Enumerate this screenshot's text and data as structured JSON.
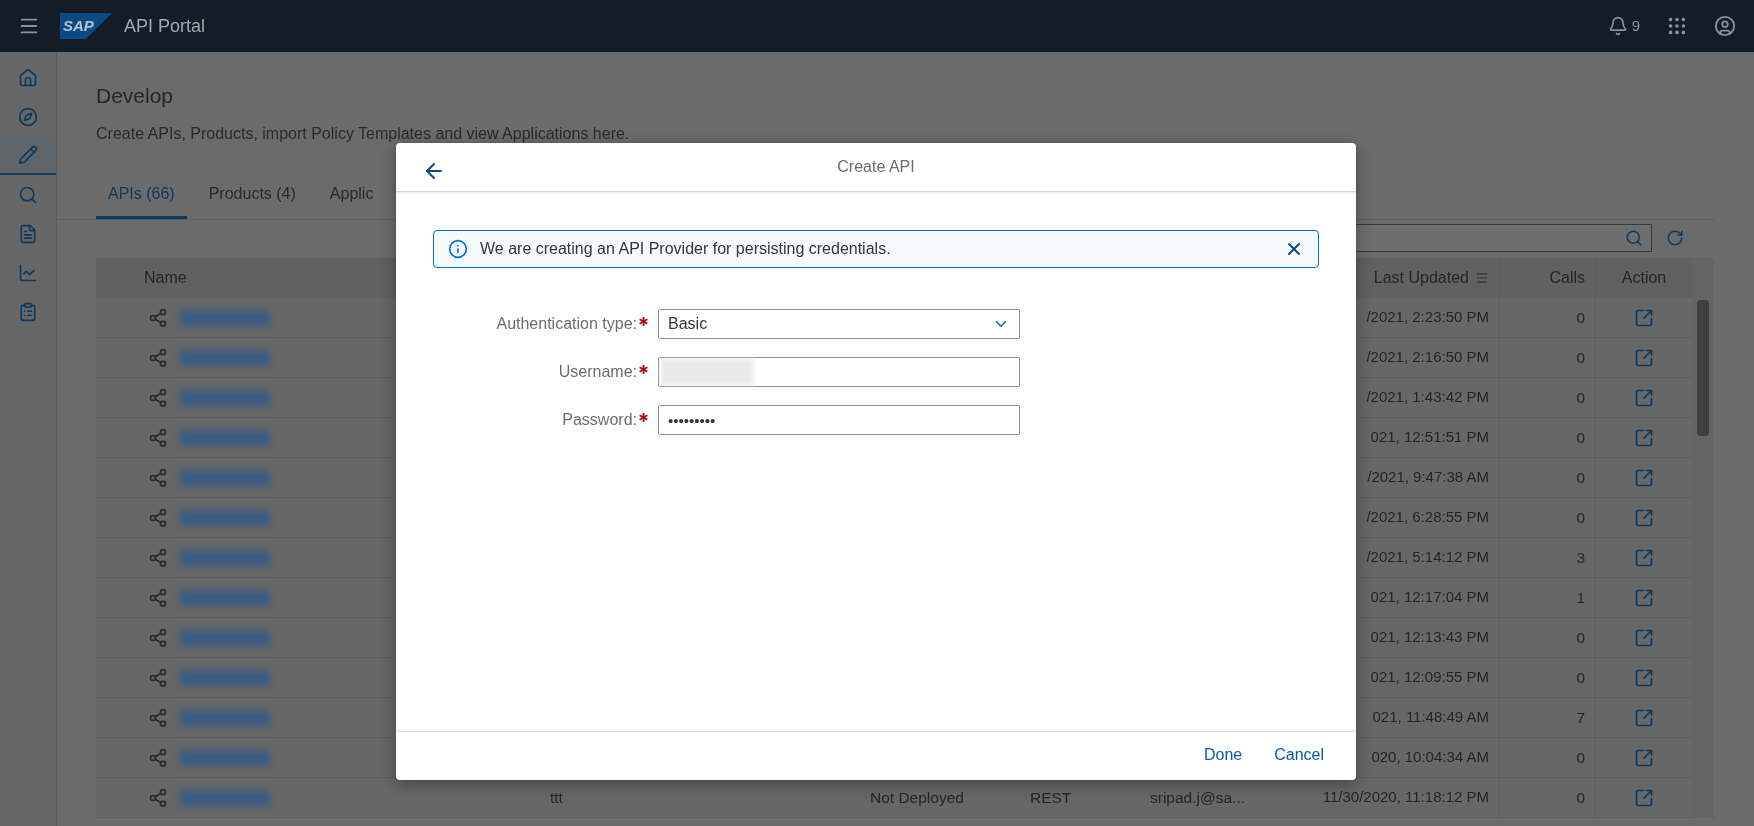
{
  "shell": {
    "logo": "SAP",
    "title": "API Portal",
    "notification_count": "9"
  },
  "nav": [
    {
      "selected": false
    },
    {
      "selected": false
    },
    {
      "selected": true
    },
    {
      "selected": false
    },
    {
      "selected": false
    },
    {
      "selected": false
    },
    {
      "selected": false
    }
  ],
  "page": {
    "title": "Develop",
    "subtitle": "Create APIs, Products, import Policy Templates and view Applications here."
  },
  "tabs": [
    {
      "label": "APIs (66)",
      "selected": true
    },
    {
      "label": "Products (4)",
      "selected": false
    },
    {
      "label": "Applic",
      "selected": false
    }
  ],
  "table": {
    "columns": [
      "Name",
      "Last Updated",
      "Calls",
      "Action"
    ],
    "rows": [
      {
        "name_blurred": true,
        "last_updated": "/2021, 2:23:50 PM",
        "calls": "0"
      },
      {
        "name_blurred": true,
        "last_updated": "/2021, 2:16:50 PM",
        "calls": "0"
      },
      {
        "name_blurred": true,
        "last_updated": "/2021, 1:43:42 PM",
        "calls": "0"
      },
      {
        "name_blurred": true,
        "last_updated": "021, 12:51:51 PM",
        "calls": "0"
      },
      {
        "name_blurred": true,
        "last_updated": "/2021, 9:47:38 AM",
        "calls": "0"
      },
      {
        "name_blurred": true,
        "last_updated": "/2021, 6:28:55 PM",
        "calls": "0"
      },
      {
        "name_blurred": true,
        "last_updated": "/2021, 5:14:12 PM",
        "calls": "3"
      },
      {
        "name_blurred": true,
        "last_updated": "021, 12:17:04 PM",
        "calls": "1"
      },
      {
        "name_blurred": true,
        "last_updated": "021, 12:13:43 PM",
        "calls": "0"
      },
      {
        "name_blurred": true,
        "last_updated": "021, 12:09:55 PM",
        "calls": "0"
      },
      {
        "name_blurred": true,
        "last_updated": "021, 11:48:49 AM",
        "calls": "7"
      },
      {
        "name_blurred": true,
        "last_updated": "020, 10:04:34 AM",
        "calls": "0"
      },
      {
        "name_blurred": true,
        "column_3": "ttt",
        "column_4": "Not Deployed",
        "column_5": "REST",
        "column_6": "sripad.j@sa...",
        "last_updated": "11/30/2020, 11:18:12 PM",
        "calls": "0"
      }
    ]
  },
  "dialog": {
    "title": "Create API",
    "message": "We are creating an API Provider for persisting credentials.",
    "fields": [
      {
        "kind": "select",
        "label": "Authentication type:",
        "required": true,
        "value": "Basic"
      },
      {
        "kind": "blurred",
        "label": "Username:",
        "required": true
      },
      {
        "kind": "password",
        "label": "Password:",
        "required": true,
        "value": "•••••••••"
      }
    ],
    "buttons": [
      "Done",
      "Cancel"
    ]
  }
}
